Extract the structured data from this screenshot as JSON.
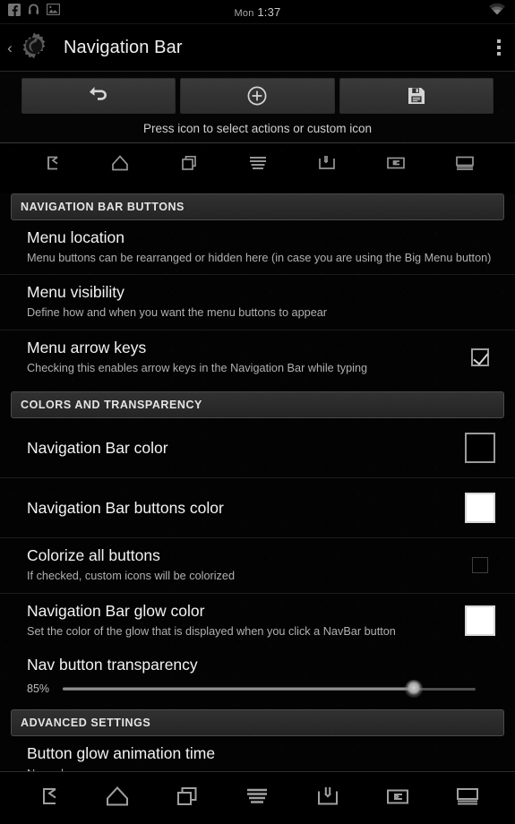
{
  "statusbar": {
    "icons": [
      "facebook-icon",
      "headphones-icon",
      "picture-icon"
    ],
    "day": "Mon",
    "time": "1:37",
    "right_icon": "wifi-icon"
  },
  "actionbar": {
    "back_glyph": "‹",
    "app_icon": "unicorn-gear-icon",
    "title": "Navigation Bar",
    "overflow_icon": "overflow-menu-icon"
  },
  "toolbar": {
    "buttons": [
      {
        "name": "reset-button",
        "icon": "undo-arrow-icon"
      },
      {
        "name": "add-button",
        "icon": "plus-circle-icon"
      },
      {
        "name": "save-button",
        "icon": "floppy-save-icon"
      }
    ],
    "hint": "Press icon to select actions or custom icon"
  },
  "preview_buttons": [
    {
      "icon": "back-arrow-icon"
    },
    {
      "icon": "home-icon"
    },
    {
      "icon": "recents-icon"
    },
    {
      "icon": "menu-lines-icon"
    },
    {
      "icon": "notifications-pull-icon"
    },
    {
      "icon": "last-app-icon"
    },
    {
      "icon": "screenshot-icon"
    }
  ],
  "sections": [
    {
      "name": "navigation-bar-buttons",
      "header": "NAVIGATION BAR BUTTONS",
      "rows": [
        {
          "name": "menu-location",
          "title": "Menu location",
          "summary": "Menu buttons can be rearranged or hidden here (in case you are using the Big Menu button)",
          "widget": "none"
        },
        {
          "name": "menu-visibility",
          "title": "Menu visibility",
          "summary": "Define how and when you want the menu buttons to appear",
          "widget": "none"
        },
        {
          "name": "menu-arrow-keys",
          "title": "Menu arrow keys",
          "summary": "Checking this enables arrow keys in the Navigation Bar while typing",
          "widget": "checkbox",
          "checked": true
        }
      ]
    },
    {
      "name": "colors-and-transparency",
      "header": "COLORS AND TRANSPARENCY",
      "rows": [
        {
          "name": "navigation-bar-color",
          "title": "Navigation Bar color",
          "summary": "",
          "widget": "swatch",
          "swatch_color": "#000000"
        },
        {
          "name": "navigation-bar-buttons-color",
          "title": "Navigation Bar buttons color",
          "summary": "",
          "widget": "swatch",
          "swatch_color": "#ffffff"
        },
        {
          "name": "colorize-all-buttons",
          "title": "Colorize all buttons",
          "summary": "If checked, custom icons will be colorized",
          "widget": "checkbox",
          "checked": false
        },
        {
          "name": "navigation-bar-glow-color",
          "title": "Navigation Bar glow color",
          "summary": "Set the color of the glow that is displayed when you click a NavBar button",
          "widget": "swatch",
          "swatch_color": "#ffffff"
        }
      ]
    }
  ],
  "slider_row": {
    "name": "nav-button-transparency",
    "title": "Nav button transparency",
    "value_label": "85%",
    "value": 85,
    "min": 0,
    "max": 100
  },
  "advanced": {
    "header": "ADVANCED SETTINGS",
    "rows": [
      {
        "name": "button-glow-animation-time",
        "title": "Button glow animation time",
        "summary": "Normal"
      }
    ]
  },
  "system_navbar": [
    {
      "icon": "back-arrow-icon"
    },
    {
      "icon": "home-icon"
    },
    {
      "icon": "recents-icon"
    },
    {
      "icon": "menu-lines-icon"
    },
    {
      "icon": "notifications-pull-icon"
    },
    {
      "icon": "last-app-icon"
    },
    {
      "icon": "screenshot-icon"
    }
  ],
  "colors": {
    "background": "#000000",
    "text_primary": "#f2f2f2",
    "text_secondary": "#b0b0b0",
    "section_header_text": "#e4e4e4"
  }
}
